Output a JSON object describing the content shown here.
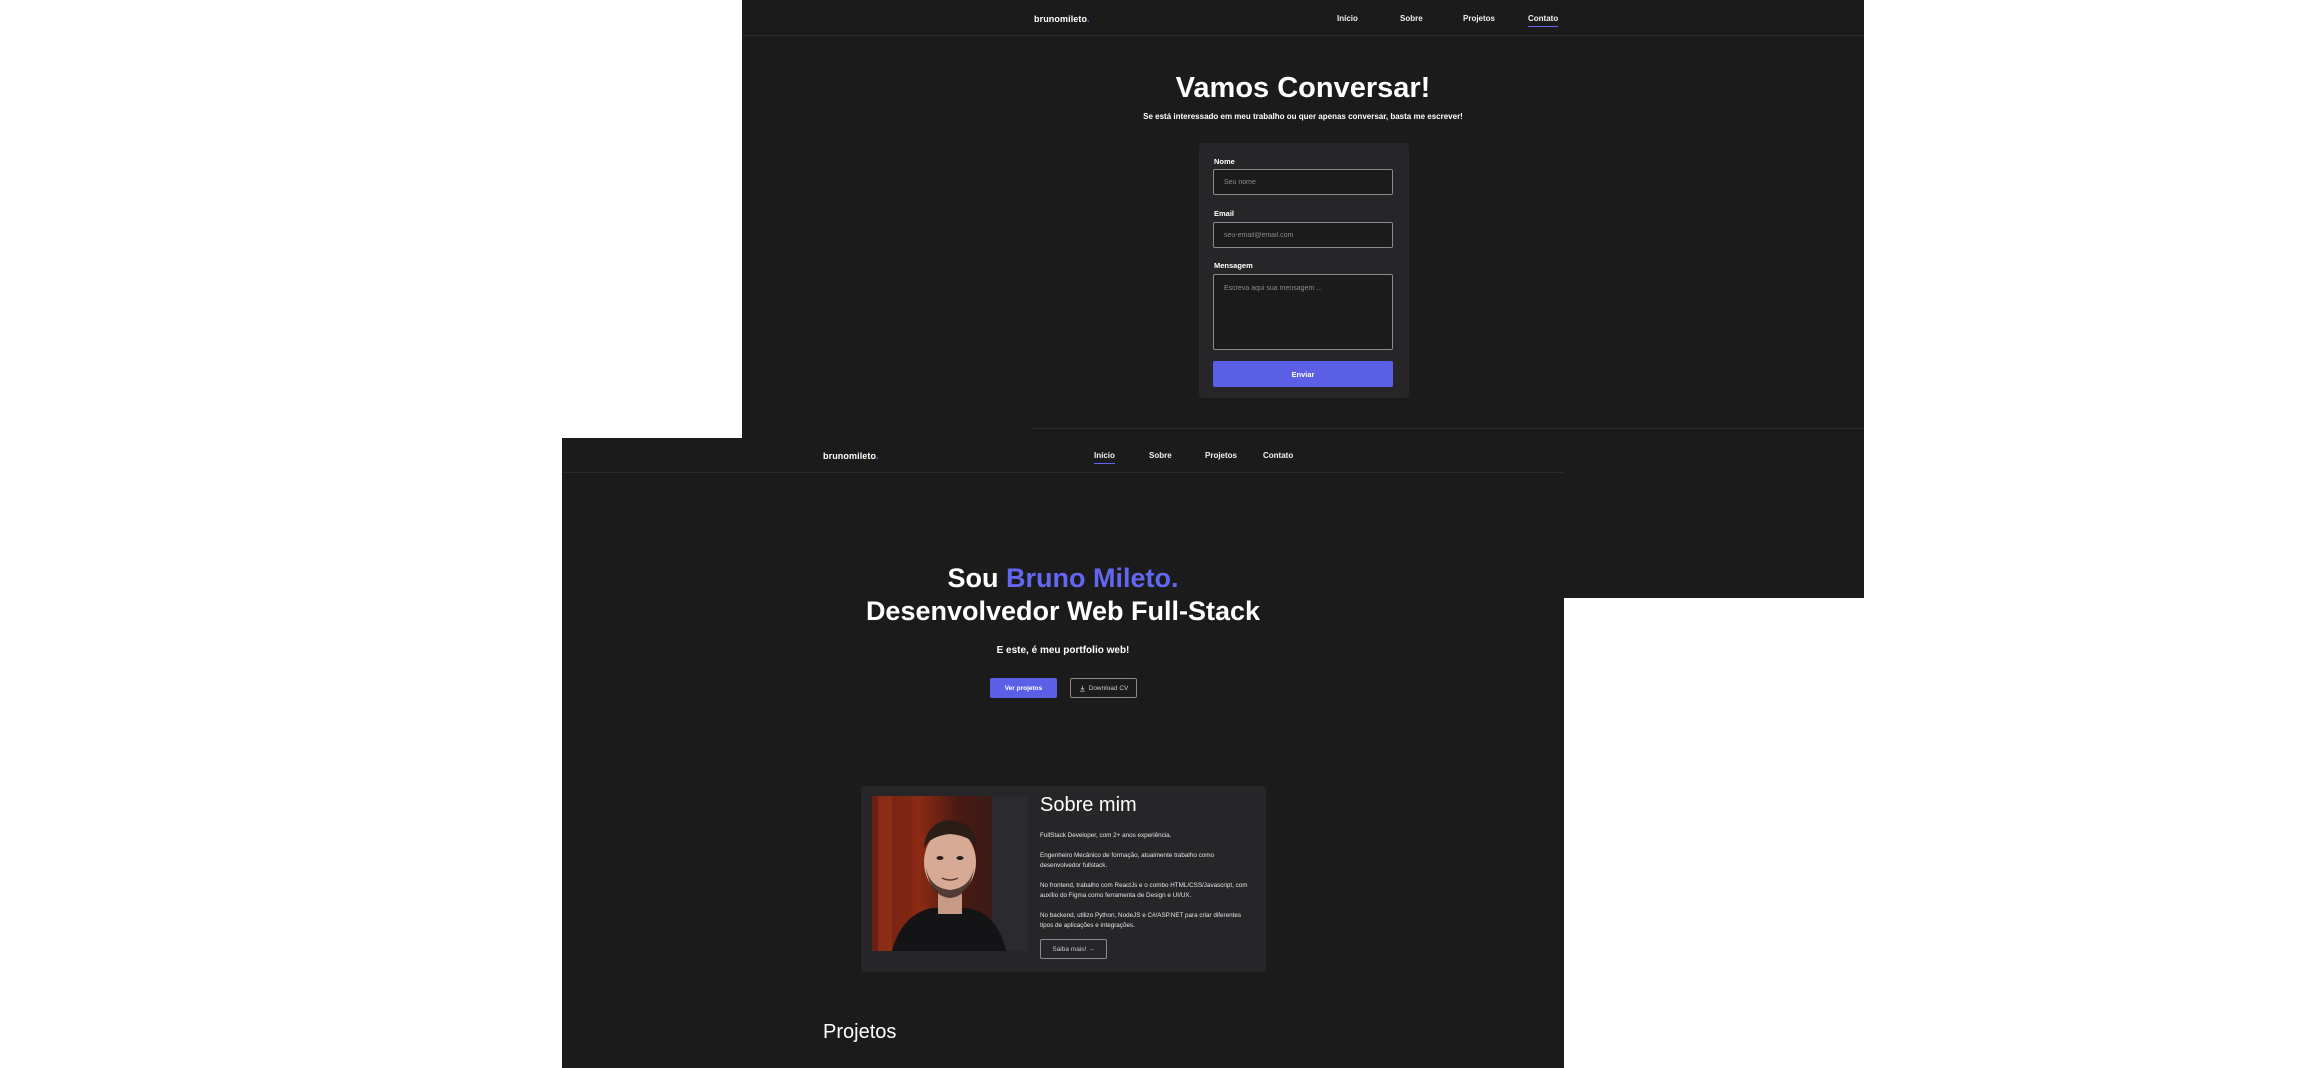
{
  "contact_page": {
    "logo": {
      "text": "brunomileto",
      "dot": "."
    },
    "nav": [
      {
        "label": "Início"
      },
      {
        "label": "Sobre"
      },
      {
        "label": "Projetos"
      },
      {
        "label": "Contato",
        "active": true
      }
    ],
    "title": "Vamos Conversar!",
    "subtitle": "Se está interessado em meu trabalho ou quer apenas conversar, basta me escrever!",
    "form": {
      "name_label": "Nome",
      "name_placeholder": "Seu nome",
      "email_label": "Email",
      "email_placeholder": "seu-email@email.com",
      "message_label": "Mensagem",
      "message_placeholder": "Escreva aqui sua mensagem ...",
      "submit_label": "Enviar"
    }
  },
  "home_page": {
    "logo": {
      "text": "brunomileto",
      "dot": "."
    },
    "nav": [
      {
        "label": "Início",
        "active": true
      },
      {
        "label": "Sobre"
      },
      {
        "label": "Projetos"
      },
      {
        "label": "Contato"
      }
    ],
    "hero": {
      "prefix": "Sou ",
      "name": "Bruno Mileto.",
      "role": "Desenvolvedor Web Full-Stack",
      "subtitle": "E este, é meu portfolio web!",
      "primary_button": "Ver projetos",
      "secondary_button": "Download CV",
      "secondary_icon": "download-icon"
    },
    "about": {
      "title": "Sobre mim",
      "paragraphs": [
        "FullStack Developer, com 2+ anos experiência.",
        "Engenheiro Mecânico de formação, atualmente trabalho como desenvolvedor fullstack.",
        "No frontend, trabalho com ReactJs e o combo HTML/CSS/Javascript, com auxílio do Figma como ferramenta de Design e UI/UX.",
        "No backend, utilizo Python, NodeJS e C#/ASP.NET para criar diferentes tipos de aplicações e integrações."
      ],
      "more_button": "Saiba mais! →"
    },
    "projects_title": "Projetos"
  },
  "colors": {
    "accent": "#6366f1",
    "button": "#5b5fe6",
    "background": "#1b1b1c",
    "card": "#262628"
  }
}
